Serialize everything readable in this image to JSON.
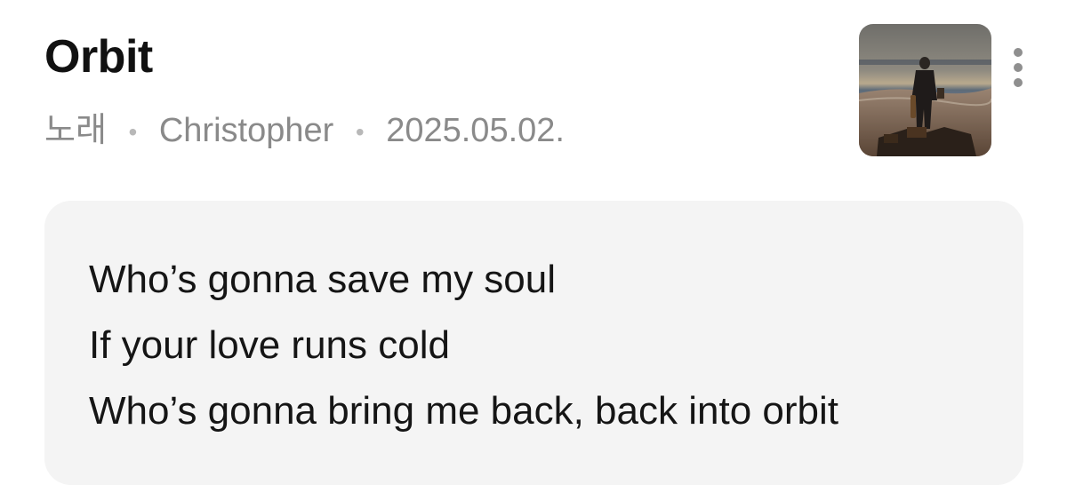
{
  "post": {
    "title": "Orbit",
    "category": "노래",
    "author": "Christopher",
    "date": "2025.05.02.",
    "separator": "•"
  },
  "thumbnail": {
    "icon": "album-cover-man-on-beach"
  },
  "menu": {
    "icon": "more-vertical-icon"
  },
  "lyrics": {
    "lines": [
      "Who’s gonna save my soul",
      "If your love runs cold",
      "Who’s gonna bring me back, back into orbit"
    ]
  },
  "colors": {
    "title": "#111111",
    "meta": "#8a8a8a",
    "card_bg": "#f4f4f4"
  }
}
